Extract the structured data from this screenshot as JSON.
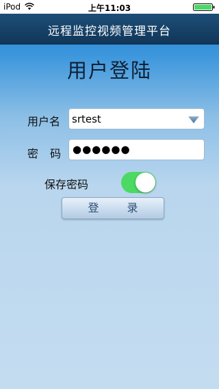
{
  "status_bar": {
    "carrier": "iPod",
    "time": "上午11:03"
  },
  "nav_bar": {
    "title": "远程监控视频管理平台"
  },
  "login": {
    "heading": "用户登陆",
    "username_label": "用户名",
    "username_value": "srtest",
    "password_label": "密 码",
    "password_mask": "●●●●●●",
    "remember_label": "保存密码",
    "remember_on": true,
    "login_button": "登 录"
  },
  "icons": {
    "wifi": "wifi-icon",
    "battery": "battery-icon",
    "dropdown": "dropdown-arrow-icon"
  },
  "colors": {
    "nav_bar": "#113658",
    "toggle_on": "#4cd964",
    "button_text": "#2c4e74"
  }
}
